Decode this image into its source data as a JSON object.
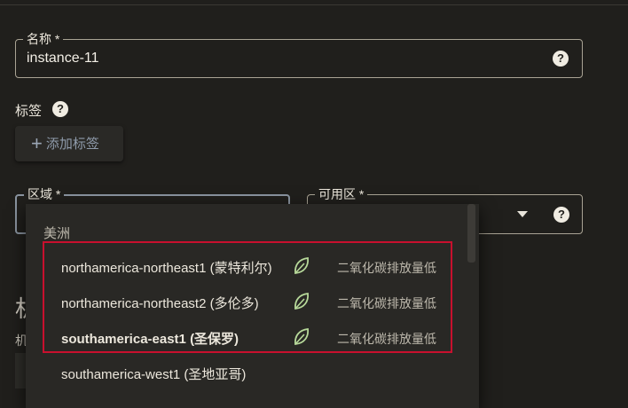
{
  "form": {
    "name_field": {
      "label": "名称 *",
      "value": "instance-11"
    },
    "tags": {
      "label": "标签",
      "add_button": "添加标签"
    },
    "region_field": {
      "label": "区域 *"
    },
    "zone_field": {
      "label": "可用区 *"
    },
    "machine_heading": "机",
    "machine_sub": "机"
  },
  "region_dropdown": {
    "group": "美洲",
    "options": [
      {
        "name": "northamerica-northeast1 (蒙特利尔)",
        "note": "二氧化碳排放量低",
        "leaf": true,
        "selected": false
      },
      {
        "name": "northamerica-northeast2 (多伦多)",
        "note": "二氧化碳排放量低",
        "leaf": true,
        "selected": false
      },
      {
        "name": "southamerica-east1 (圣保罗)",
        "note": "二氧化碳排放量低",
        "leaf": true,
        "selected": true
      },
      {
        "name": "southamerica-west1 (圣地亚哥)",
        "note": "",
        "leaf": false,
        "selected": false
      }
    ]
  },
  "icons": {
    "help": "help-circle-icon",
    "add": "plus-icon",
    "leaf": "leaf-icon",
    "dropdown": "chevron-down-icon"
  },
  "colors": {
    "background": "#201f1c",
    "dropdown_bg": "#292825",
    "highlight_border": "#c8102e",
    "leaf_green": "#b7d99a"
  }
}
